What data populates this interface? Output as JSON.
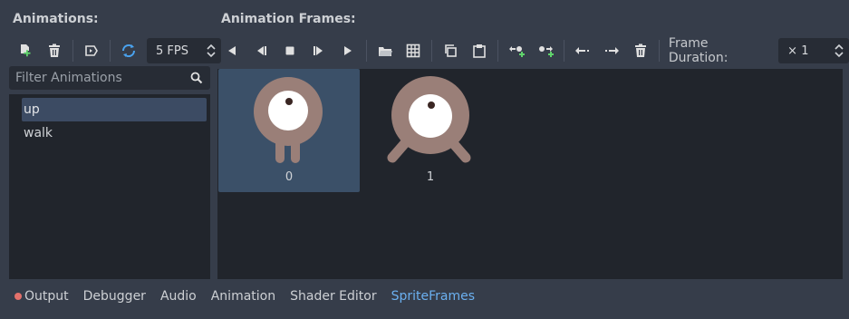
{
  "headers": {
    "animations": "Animations:",
    "frames": "Animation Frames:"
  },
  "left_toolbar": {
    "fps": "5 FPS"
  },
  "right_toolbar": {
    "frame_duration_label": "Frame Duration:",
    "frame_duration_value": "× 1"
  },
  "filter": {
    "placeholder": "Filter Animations"
  },
  "animations": [
    {
      "label": "up",
      "selected": true
    },
    {
      "label": "walk",
      "selected": false
    }
  ],
  "frames": [
    {
      "label": "0",
      "selected": true
    },
    {
      "label": "1",
      "selected": false
    }
  ],
  "bottom_tabs": [
    "Output",
    "Debugger",
    "Audio",
    "Animation",
    "Shader Editor",
    "SpriteFrames"
  ],
  "active_tab": "SpriteFrames",
  "colors": {
    "accent": "#6bb0f0",
    "selection": "#3b5068",
    "creature": "#9a7f78",
    "error_dot": "#e4716b"
  }
}
